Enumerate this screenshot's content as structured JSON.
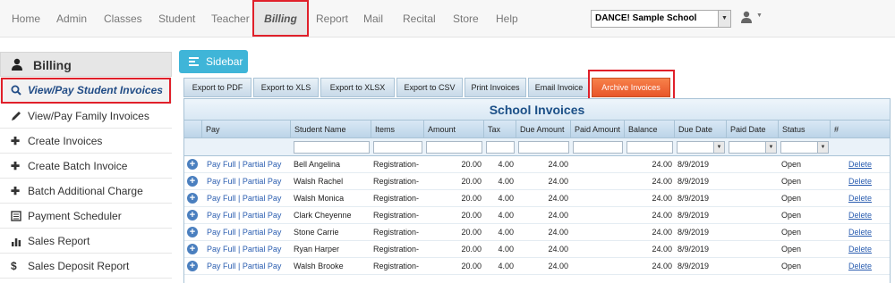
{
  "nav": {
    "items": [
      "Home",
      "Admin",
      "Classes",
      "Student",
      "Teacher",
      "Billing",
      "Report",
      "Mail",
      "Recital",
      "Store",
      "Help"
    ],
    "school_select": "DANCE! Sample School"
  },
  "sidebar": {
    "title": "Billing",
    "items": [
      {
        "label": "View/Pay Student Invoices",
        "icon": "search-icon"
      },
      {
        "label": "View/Pay Family Invoices",
        "icon": "pencil-icon"
      },
      {
        "label": "Create Invoices",
        "icon": "plus-icon"
      },
      {
        "label": "Create Batch Invoice",
        "icon": "plus-icon"
      },
      {
        "label": "Batch Additional Charge",
        "icon": "plus-icon"
      },
      {
        "label": "Payment Scheduler",
        "icon": "calendar-icon"
      },
      {
        "label": "Sales Report",
        "icon": "bar-chart-icon"
      },
      {
        "label": "Sales Deposit Report",
        "icon": "dollar-icon"
      }
    ]
  },
  "sidebar_button": "Sidebar",
  "toolbar": [
    "Export to PDF",
    "Export to XLS",
    "Export to XLSX",
    "Export to CSV",
    "Print Invoices",
    "Email Invoice",
    "Archive Invoices"
  ],
  "grid": {
    "title": "School Invoices",
    "columns": [
      "Pay",
      "Student Name",
      "Items",
      "Amount",
      "Tax",
      "Due Amount",
      "Paid Amount",
      "Balance",
      "Due Date",
      "Paid Date",
      "Status",
      "#"
    ],
    "rows": [
      {
        "pay": "Pay Full | Partial Pay",
        "name": "Bell Angelina",
        "items": "Registration-",
        "amount": "20.00",
        "tax": "4.00",
        "due": "24.00",
        "paid": "",
        "balance": "24.00",
        "due_date": "8/9/2019",
        "paid_date": "",
        "status": "Open",
        "action": "Delete"
      },
      {
        "pay": "Pay Full | Partial Pay",
        "name": "Walsh Rachel",
        "items": "Registration-",
        "amount": "20.00",
        "tax": "4.00",
        "due": "24.00",
        "paid": "",
        "balance": "24.00",
        "due_date": "8/9/2019",
        "paid_date": "",
        "status": "Open",
        "action": "Delete"
      },
      {
        "pay": "Pay Full | Partial Pay",
        "name": "Walsh Monica",
        "items": "Registration-",
        "amount": "20.00",
        "tax": "4.00",
        "due": "24.00",
        "paid": "",
        "balance": "24.00",
        "due_date": "8/9/2019",
        "paid_date": "",
        "status": "Open",
        "action": "Delete"
      },
      {
        "pay": "Pay Full | Partial Pay",
        "name": "Clark Cheyenne",
        "items": "Registration-",
        "amount": "20.00",
        "tax": "4.00",
        "due": "24.00",
        "paid": "",
        "balance": "24.00",
        "due_date": "8/9/2019",
        "paid_date": "",
        "status": "Open",
        "action": "Delete"
      },
      {
        "pay": "Pay Full | Partial Pay",
        "name": "Stone Carrie",
        "items": "Registration-",
        "amount": "20.00",
        "tax": "4.00",
        "due": "24.00",
        "paid": "",
        "balance": "24.00",
        "due_date": "8/9/2019",
        "paid_date": "",
        "status": "Open",
        "action": "Delete"
      },
      {
        "pay": "Pay Full | Partial Pay",
        "name": "Ryan Harper",
        "items": "Registration-",
        "amount": "20.00",
        "tax": "4.00",
        "due": "24.00",
        "paid": "",
        "balance": "24.00",
        "due_date": "8/9/2019",
        "paid_date": "",
        "status": "Open",
        "action": "Delete"
      },
      {
        "pay": "Pay Full | Partial Pay",
        "name": "Walsh Brooke",
        "items": "Registration-",
        "amount": "20.00",
        "tax": "4.00",
        "due": "24.00",
        "paid": "",
        "balance": "24.00",
        "due_date": "8/9/2019",
        "paid_date": "",
        "status": "Open",
        "action": "Delete"
      }
    ]
  },
  "colors": {
    "highlight": "#e0202a",
    "sidebar_button": "#3fb5d8",
    "archive_button": "#e8562a",
    "grid_title": "#1b4f87",
    "link": "#2a5db0"
  }
}
